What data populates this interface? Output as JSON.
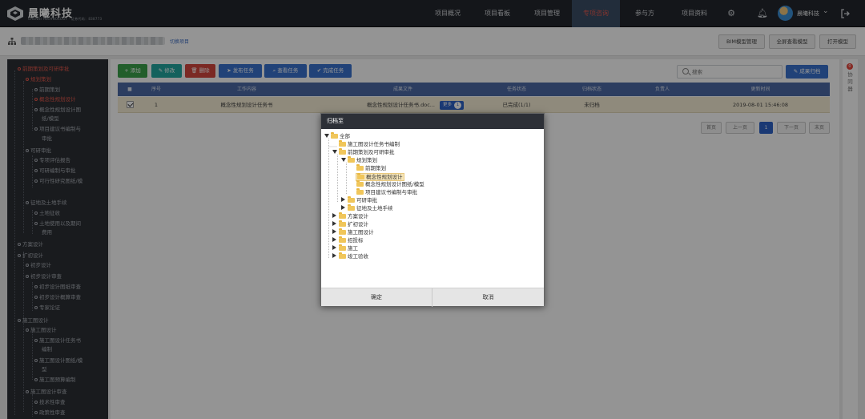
{
  "brand": {
    "name": "晨曦科技",
    "sub": "CHENXI TECHNOLOGY · 证券代码：838773"
  },
  "nav": [
    "项目概况",
    "项目看板",
    "项目管理",
    "专项咨询",
    "参与方",
    "项目资料"
  ],
  "user": {
    "name": "晨曦科技"
  },
  "subbar": {
    "switch_label": "切换项目",
    "buttons": [
      "BIM模型管理",
      "全屏查看模型",
      "打开模型"
    ]
  },
  "sidebar": [
    "前期策划及可研审批",
    "规划策划",
    "前期策划",
    "概念性规划设计",
    "概念性规划设计图",
    "纸/模型",
    "项目建议书编制与",
    "审批",
    "可研审批",
    "专项评估报告",
    "可研编制与审批",
    "可行性研究图纸/模",
    "征地及土地手续",
    "土地征收",
    "土地使用以及期间",
    "费用",
    "方案设计",
    "扩初设计",
    "初步设计",
    "初步设计审查",
    "初步设计图纸审查",
    "初步设计概算审查",
    "专家论证",
    "施工图设计",
    "施工图设计",
    "施工图设计任务书",
    "编制",
    "施工图设计图纸/模",
    "型",
    "施工图预算编制",
    "施工图设计审查",
    "技术性审查",
    "政策性审查"
  ],
  "actions": [
    "添加",
    "修改",
    "删除",
    "发布任务",
    "查看任务",
    "完成任务"
  ],
  "search": {
    "placeholder": "搜索"
  },
  "result_button": "成果归档",
  "table": {
    "headers": [
      "序号",
      "工作内容",
      "成果文件",
      "任务状态",
      "归档状态",
      "负责人",
      "更新时间"
    ],
    "rows": [
      {
        "no": "1",
        "content": "概念性规划设计任务书",
        "file": "概念性规划设计任务书.doc...",
        "chip": "更多",
        "chip_count": "1",
        "task_status": "已完成(1/1)",
        "archive_status": "未归档",
        "owner": "",
        "updated": "2019-08-01 15:46:08"
      }
    ]
  },
  "pager": [
    "首页",
    "上一页",
    "1",
    "下一页",
    "末页"
  ],
  "right_rail": {
    "badge": "0",
    "label": "协同器"
  },
  "dialog": {
    "title": "归档至",
    "nodes": [
      "全部",
      "施工图设计任务书编制",
      "前期策划及可研审批",
      "规划策划",
      "前期策划",
      "概念性规划设计",
      "概念性规划设计图纸/模型",
      "项目建议书编制与审批",
      "可研审批",
      "征地及土地手续",
      "方案设计",
      "扩初设计",
      "施工图设计",
      "招投标",
      "施工",
      "竣工验收"
    ],
    "ok": "确定",
    "cancel": "取消"
  }
}
